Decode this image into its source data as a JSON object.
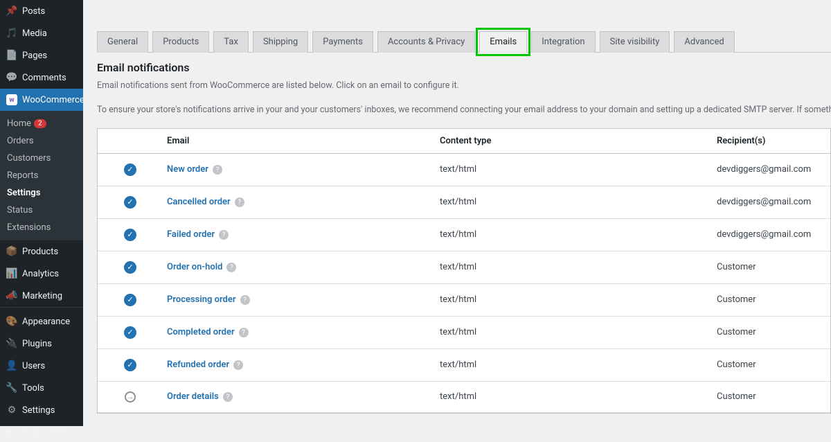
{
  "sidebar": {
    "items_top": [
      {
        "icon": "pin",
        "label": "Posts"
      },
      {
        "icon": "media",
        "label": "Media"
      },
      {
        "icon": "page",
        "label": "Pages"
      },
      {
        "icon": "comment",
        "label": "Comments"
      }
    ],
    "woocommerce": {
      "label": "WooCommerce"
    },
    "sub": [
      {
        "label": "Home",
        "badge": "2"
      },
      {
        "label": "Orders"
      },
      {
        "label": "Customers"
      },
      {
        "label": "Reports"
      },
      {
        "label": "Settings",
        "current": true
      },
      {
        "label": "Status"
      },
      {
        "label": "Extensions"
      }
    ],
    "items_mid": [
      {
        "icon": "box",
        "label": "Products"
      },
      {
        "icon": "chart",
        "label": "Analytics"
      },
      {
        "icon": "mega",
        "label": "Marketing"
      }
    ],
    "items_bot": [
      {
        "icon": "brush",
        "label": "Appearance"
      },
      {
        "icon": "plug",
        "label": "Plugins"
      },
      {
        "icon": "user",
        "label": "Users"
      },
      {
        "icon": "tool",
        "label": "Tools"
      },
      {
        "icon": "slider",
        "label": "Settings"
      }
    ],
    "collapse": "Collapse menu"
  },
  "tabs": [
    "General",
    "Products",
    "Tax",
    "Shipping",
    "Payments",
    "Accounts & Privacy",
    "Emails",
    "Integration",
    "Site visibility",
    "Advanced"
  ],
  "active_tab": "Emails",
  "section": {
    "title": "Email notifications",
    "desc1": "Email notifications sent from WooCommerce are listed below. Click on an email to configure it.",
    "desc2": "To ensure your store's notifications arrive in your and your customers' inboxes, we recommend connecting your email address to your domain and setting up a dedicated SMTP server. If something doesn't seem to be sending"
  },
  "table": {
    "headers": {
      "email": "Email",
      "type": "Content type",
      "recipient": "Recipient(s)"
    },
    "rows": [
      {
        "status": "on",
        "name": "New order",
        "type": "text/html",
        "recipient": "devdiggers@gmail.com"
      },
      {
        "status": "on",
        "name": "Cancelled order",
        "type": "text/html",
        "recipient": "devdiggers@gmail.com"
      },
      {
        "status": "on",
        "name": "Failed order",
        "type": "text/html",
        "recipient": "devdiggers@gmail.com"
      },
      {
        "status": "on",
        "name": "Order on-hold",
        "type": "text/html",
        "recipient": "Customer"
      },
      {
        "status": "on",
        "name": "Processing order",
        "type": "text/html",
        "recipient": "Customer"
      },
      {
        "status": "on",
        "name": "Completed order",
        "type": "text/html",
        "recipient": "Customer"
      },
      {
        "status": "on",
        "name": "Refunded order",
        "type": "text/html",
        "recipient": "Customer"
      },
      {
        "status": "manual",
        "name": "Order details",
        "type": "text/html",
        "recipient": "Customer"
      }
    ]
  }
}
